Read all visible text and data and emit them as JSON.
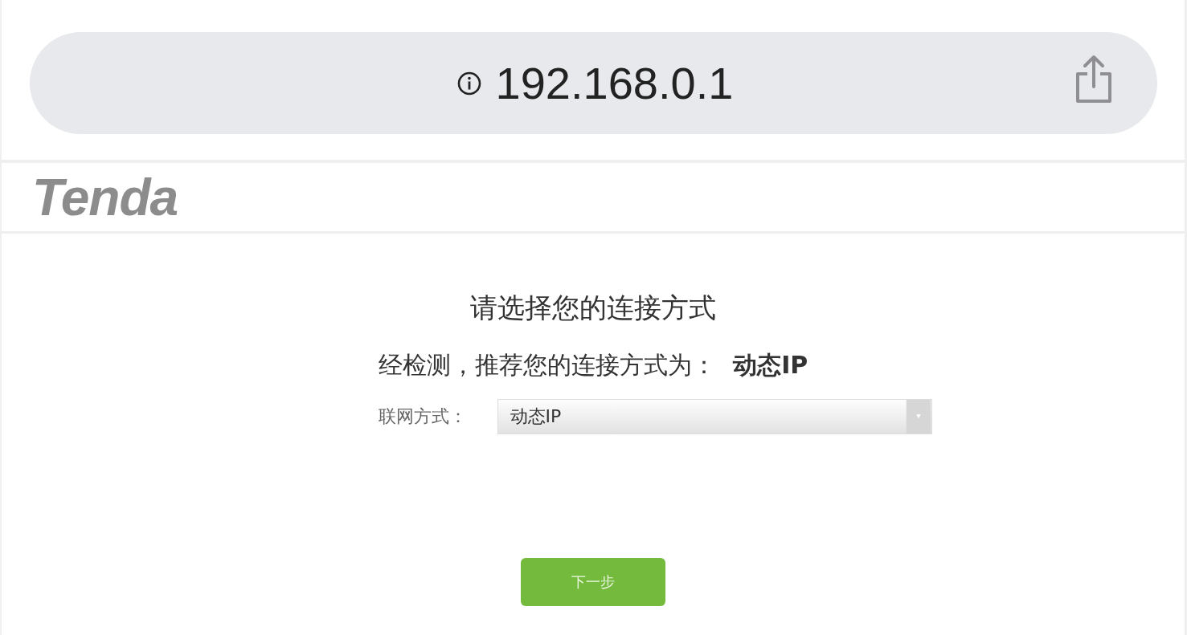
{
  "address_bar": {
    "url": "192.168.0.1"
  },
  "header": {
    "logo": "Tenda"
  },
  "setup": {
    "title": "请选择您的连接方式",
    "recommendation": "经检测，推荐您的连接方式为： **动态IP**",
    "connection_field": {
      "label": "联网方式：",
      "value": "动态IP"
    },
    "next_button": "下一步"
  }
}
